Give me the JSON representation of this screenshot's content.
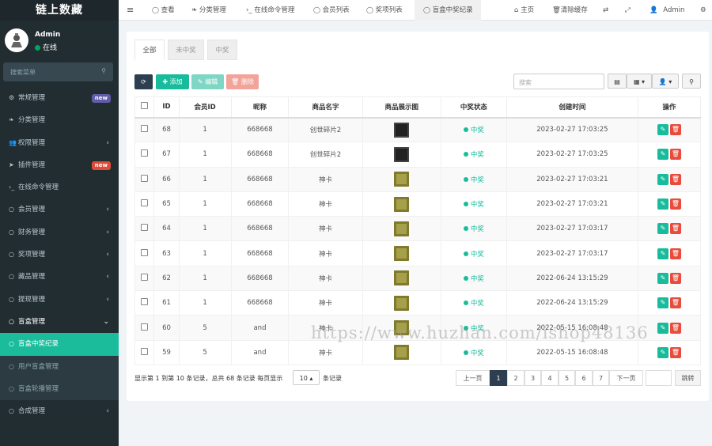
{
  "sidebar": {
    "logo": "链上数藏",
    "user": {
      "name": "Admin",
      "status": "在线"
    },
    "search_placeholder": "搜索菜单",
    "items": [
      {
        "label": "常规管理",
        "icon": "gears-icon",
        "badge": "new",
        "badge_color": "#605ca8"
      },
      {
        "label": "分类管理",
        "icon": "leaf-icon"
      },
      {
        "label": "权限管理",
        "icon": "group-icon",
        "arrow": "‹"
      },
      {
        "label": "插件管理",
        "icon": "rocket-icon",
        "badge": "new",
        "badge_color": "#dd4b39"
      },
      {
        "label": "在线命令管理",
        "icon": "terminal-icon"
      },
      {
        "label": "会员管理",
        "icon": "circle-icon",
        "arrow": "‹"
      },
      {
        "label": "财务管理",
        "icon": "circle-icon",
        "arrow": "‹"
      },
      {
        "label": "奖项管理",
        "icon": "circle-icon",
        "arrow": "‹"
      },
      {
        "label": "藏品管理",
        "icon": "circle-icon",
        "arrow": "‹"
      },
      {
        "label": "提现管理",
        "icon": "circle-icon",
        "arrow": "‹"
      },
      {
        "label": "盲盒管理",
        "icon": "circle-icon",
        "arrow": "⌄"
      },
      {
        "label": "盲盒中奖纪录",
        "icon": "circle-icon"
      },
      {
        "label": "用户盲盒管理",
        "icon": "circle-icon"
      },
      {
        "label": "盲盒轮播管理",
        "icon": "circle-icon"
      },
      {
        "label": "合成管理",
        "icon": "circle-icon",
        "arrow": "‹"
      }
    ]
  },
  "topbar": {
    "menu_icon": "≡",
    "tabs": [
      "查看",
      "分类管理",
      "在线命令管理",
      "会员列表",
      "奖项列表",
      "盲盒中奖纪录"
    ],
    "home": "主页",
    "clear_cache": "清除缓存",
    "user": "Admin"
  },
  "content": {
    "tabs": [
      "全部",
      "未中奖",
      "中奖"
    ],
    "buttons": {
      "add": "添加",
      "edit": "编辑",
      "delete": "删除"
    },
    "search_placeholder": "搜索",
    "table": {
      "headers": [
        "ID",
        "会员ID",
        "昵称",
        "商品名字",
        "商品展示图",
        "中奖状态",
        "创建时间",
        "操作"
      ],
      "rows": [
        {
          "id": "68",
          "member_id": "1",
          "nickname": "668668",
          "product": "创世碎片2",
          "image": "dark",
          "status": "中奖",
          "created": "2023-02-27 17:03:25"
        },
        {
          "id": "67",
          "member_id": "1",
          "nickname": "668668",
          "product": "创世碎片2",
          "image": "dark",
          "status": "中奖",
          "created": "2023-02-27 17:03:25"
        },
        {
          "id": "66",
          "member_id": "1",
          "nickname": "668668",
          "product": "神卡",
          "image": "gold",
          "status": "中奖",
          "created": "2023-02-27 17:03:21"
        },
        {
          "id": "65",
          "member_id": "1",
          "nickname": "668668",
          "product": "神卡",
          "image": "gold",
          "status": "中奖",
          "created": "2023-02-27 17:03:21"
        },
        {
          "id": "64",
          "member_id": "1",
          "nickname": "668668",
          "product": "神卡",
          "image": "gold",
          "status": "中奖",
          "created": "2023-02-27 17:03:17"
        },
        {
          "id": "63",
          "member_id": "1",
          "nickname": "668668",
          "product": "神卡",
          "image": "gold",
          "status": "中奖",
          "created": "2023-02-27 17:03:17"
        },
        {
          "id": "62",
          "member_id": "1",
          "nickname": "668668",
          "product": "神卡",
          "image": "gold",
          "status": "中奖",
          "created": "2022-06-24 13:15:29"
        },
        {
          "id": "61",
          "member_id": "1",
          "nickname": "668668",
          "product": "神卡",
          "image": "gold",
          "status": "中奖",
          "created": "2022-06-24 13:15:29"
        },
        {
          "id": "60",
          "member_id": "5",
          "nickname": "and",
          "product": "神卡",
          "image": "gold",
          "status": "中奖",
          "created": "2022-05-15 16:08:48"
        },
        {
          "id": "59",
          "member_id": "5",
          "nickname": "and",
          "product": "神卡",
          "image": "gold",
          "status": "中奖",
          "created": "2022-05-15 16:08:48"
        }
      ]
    },
    "footer_info_prefix": "显示第 1 到第 10 条记录，总共 68 条记录 每页显示",
    "page_size": "10",
    "footer_info_suffix": "条记录",
    "pagination": {
      "prev": "上一页",
      "pages": [
        "1",
        "2",
        "3",
        "4",
        "5",
        "6",
        "7"
      ],
      "current": "1",
      "next": "下一页",
      "jump": "跳转"
    }
  },
  "watermark": "https://www.huzhan.com/ishop48136"
}
